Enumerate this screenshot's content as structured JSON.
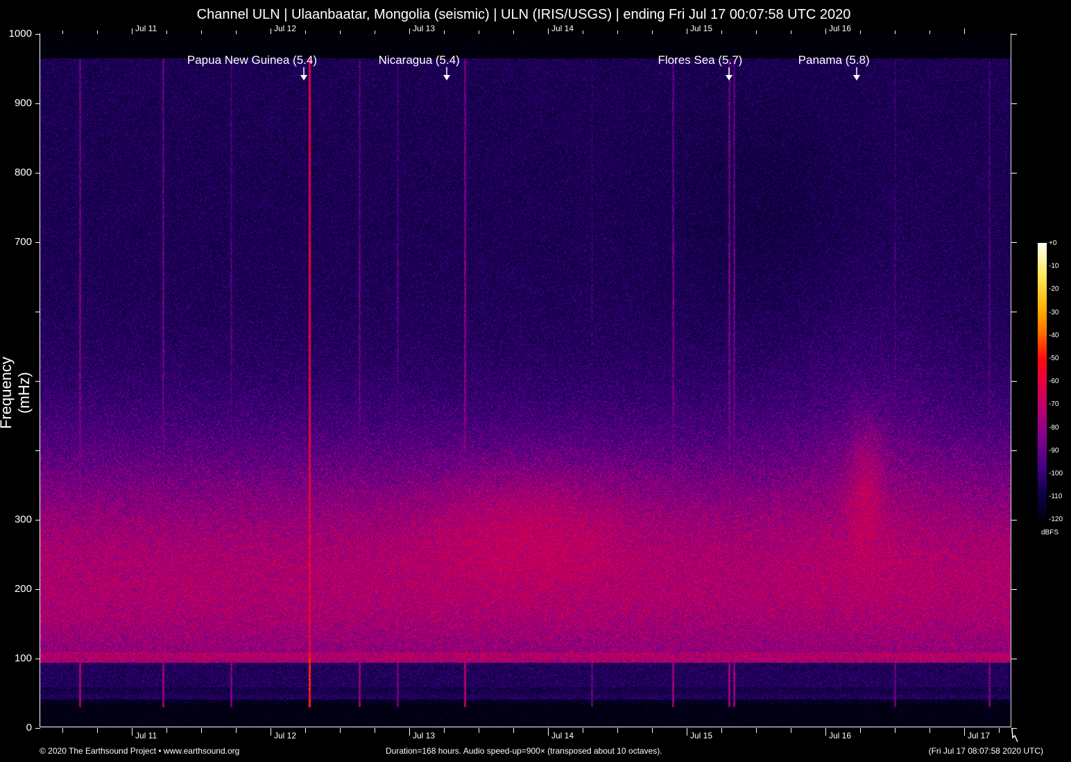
{
  "title": "Channel ULN | Ulaanbaatar, Mongolia (seismic) | ULN (IRIS/USGS) | ending Fri Jul 17 00:07:58 UTC 2020",
  "chart_data": {
    "type": "heatmap",
    "title": "Channel ULN | Ulaanbaatar, Mongolia (seismic) | ULN (IRIS/USGS) | ending Fri Jul 17 00:07:58 UTC 2020",
    "xlabel": "",
    "ylabel": "Frequency (mHz)",
    "xlim_hours": [
      0,
      168
    ],
    "ylim": [
      0,
      1000
    ],
    "y_ticks": [
      0,
      100,
      200,
      300,
      400,
      500,
      600,
      700,
      800,
      900,
      1000
    ],
    "y_tick_labels": [
      "0",
      "100",
      "200",
      "300",
      "",
      "",
      "",
      "700",
      "800",
      "900",
      "1000"
    ],
    "x_ticks": [
      {
        "label": "Jul 11",
        "hour": 15.84
      },
      {
        "label": "Jul 12",
        "hour": 39.84
      },
      {
        "label": "Jul 13",
        "hour": 63.84
      },
      {
        "label": "Jul 14",
        "hour": 87.84
      },
      {
        "label": "Jul 15",
        "hour": 111.84
      },
      {
        "label": "Jul 16",
        "hour": 135.84
      },
      {
        "label": "Jul 17",
        "hour": 159.84
      }
    ],
    "events": [
      {
        "label": "Papua New Guinea (5.4)",
        "hour": 45.6
      },
      {
        "label": "Nicaragua (5.4)",
        "hour": 70.3
      },
      {
        "label": "Flores Sea (5.7)",
        "hour": 119.2
      },
      {
        "label": "Panama (5.8)",
        "hour": 141.2
      }
    ],
    "colorbar": {
      "unit": "dBFS",
      "range": [
        -120,
        0
      ],
      "tick_labels": [
        "+0",
        "-10",
        "-20",
        "-30",
        "-40",
        "-50",
        "-60",
        "-70",
        "-80",
        "-90",
        "-100",
        "-110",
        "-120"
      ]
    },
    "colors": {
      "low": "#000018",
      "mid": "#b0007a",
      "high": "#fffff0"
    }
  },
  "footer": {
    "copyright": "© 2020 The Earthsound Project • www.earthsound.org",
    "info": "Duration=168 hours. Audio speed-up=900× (transposed about 10 octaves).",
    "timestamp": "(Fri Jul 17 08:07:58 2020 UTC)"
  }
}
